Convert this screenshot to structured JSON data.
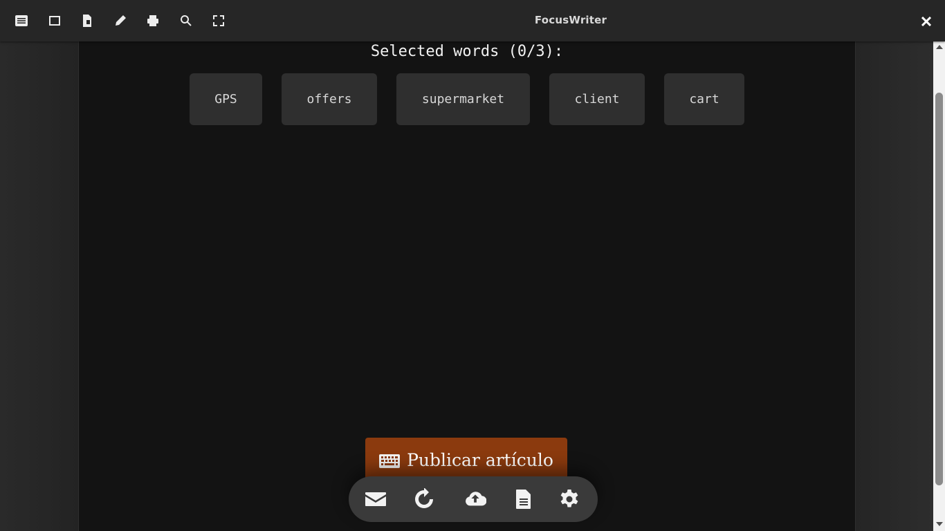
{
  "app": {
    "title": "FocusWriter"
  },
  "toolbar": {
    "icons": [
      "list-icon",
      "square-icon",
      "document-icon",
      "pencil-icon",
      "printer-icon",
      "search-icon",
      "fullscreen-icon"
    ],
    "close_icon": "close-icon"
  },
  "editor": {
    "selected_words_label": "Selected words (0/3):",
    "words": [
      "GPS",
      "offers",
      "supermarket",
      "client",
      "cart"
    ]
  },
  "publish": {
    "label": "Publicar artículo",
    "icon": "keyboard-icon",
    "color": "#8b3a0e"
  },
  "dock": {
    "icons": [
      "envelope-icon",
      "refresh-icon",
      "cloud-upload-icon",
      "file-icon",
      "gear-icon"
    ]
  },
  "colors": {
    "background": "#2b2b2b",
    "editor": "#131313",
    "chip": "#2f2f2f",
    "accent": "#8b3a0e"
  }
}
